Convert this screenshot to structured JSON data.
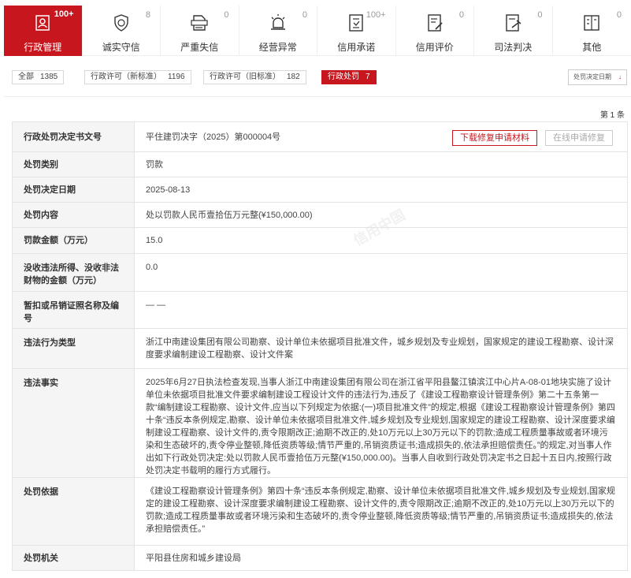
{
  "categories": [
    {
      "label": "行政管理",
      "count": "100+",
      "icon": "admin-icon",
      "active": true
    },
    {
      "label": "诚实守信",
      "count": "8",
      "icon": "honesty-shield-icon"
    },
    {
      "label": "严重失信",
      "count": "0",
      "icon": "dishonest-list-icon"
    },
    {
      "label": "经营异常",
      "count": "0",
      "icon": "alarm-icon"
    },
    {
      "label": "信用承诺",
      "count": "100+",
      "icon": "promise-doc-icon"
    },
    {
      "label": "信用评价",
      "count": "0",
      "icon": "evaluation-doc-icon"
    },
    {
      "label": "司法判决",
      "count": "0",
      "icon": "judgment-doc-icon"
    },
    {
      "label": "其他",
      "count": "0",
      "icon": "other-doc-icon"
    }
  ],
  "filters": [
    {
      "label": "全部",
      "count": "1385"
    },
    {
      "label": "行政许可（新标准）",
      "count": "1196"
    },
    {
      "label": "行政许可（旧标准）",
      "count": "182"
    },
    {
      "label": "行政处罚",
      "count": "7",
      "active": true
    }
  ],
  "sort": {
    "label": "处罚决定日期",
    "arrow": "↓"
  },
  "page": "第 1 条",
  "actions": {
    "download": "下载修复申请材料",
    "online": "在线申请修复"
  },
  "watermark": "信用中国",
  "rows": [
    {
      "key": "行政处罚决定书文号",
      "value": "平住建罚决字（2025）第000004号"
    },
    {
      "key": "处罚类别",
      "value": "罚款"
    },
    {
      "key": "处罚决定日期",
      "value": "2025-08-13"
    },
    {
      "key": "处罚内容",
      "value": "处以罚款人民币壹拾伍万元整(¥150,000.00)"
    },
    {
      "key": "罚款金额（万元）",
      "value": "15.0"
    },
    {
      "key": "没收违法所得、没收非法财物的金额（万元）",
      "value": "0.0"
    },
    {
      "key": "暂扣或吊销证照名称及编号",
      "value": "— —"
    },
    {
      "key": "违法行为类型",
      "value": "浙江中南建设集团有限公司勘察、设计单位未依据项目批准文件，城乡规划及专业规划，国家规定的建设工程勘察、设计深度要求编制建设工程勘察、设计文件案"
    },
    {
      "key": "违法事实",
      "value": "2025年6月27日执法检查发现,当事人浙江中南建设集团有限公司在浙江省平阳县鳌江镇滨江中心片A-08-01地块实施了设计单位未依据项目批准文件要求编制建设工程设计文件的违法行为,违反了《建设工程勘察设计管理条例》第二十五条第一款“编制建设工程勘察、设计文件,应当以下列规定为依据:(一)项目批准文件”的规定,根据《建设工程勘察设计管理条例》第四十条“违反本条例规定,勘察、设计单位未依据项目批准文件,城乡规划及专业规划,国家规定的建设工程勘察、设计深度要求编制建设工程勘察、设计文件的,责令限期改正;逾期不改正的,处10万元以上30万元以下的罚款;造成工程质量事故或者环境污染和生态破坏的,责令停业整顿,降低资质等级;情节严重的,吊销资质证书;造成损失的,依法承担赔偿责任。”的规定,对当事人作出如下行政处罚决定:处以罚款人民币壹拾伍万元整(¥150,000.00)。当事人自收到行政处罚决定书之日起十五日内,按照行政处罚决定书载明的履行方式履行。"
    },
    {
      "key": "处罚依据",
      "value": "《建设工程勘察设计管理条例》第四十条“违反本条例规定,勘察、设计单位未依据项目批准文件,城乡规划及专业规划,国家规定的建设工程勘察、设计深度要求编制建设工程勘察、设计文件的,责令限期改正;逾期不改正的,处10万元以上30万元以下的罚款;造成工程质量事故或者环境污染和生态破坏的,责令停业整顿,降低资质等级;情节严重的,吊销资质证书;造成损失的,依法承担赔偿责任。”"
    },
    {
      "key": "处罚机关",
      "value": "平阳县住房和城乡建设局"
    }
  ]
}
